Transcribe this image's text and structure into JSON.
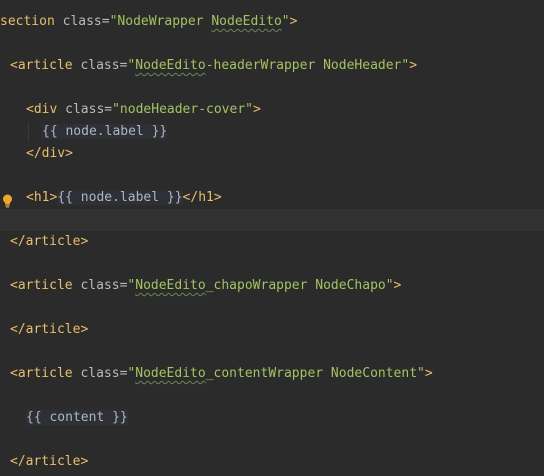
{
  "editor": {
    "lines": {
      "l1": {
        "tag_open": "section",
        "attr_name": "class",
        "attr_value_a": "\"NodeWrapper ",
        "attr_value_b": "NodeEdito",
        "attr_value_c": "\"",
        "tag_close": ">"
      },
      "l2": {
        "tag_open": "<article",
        "attr_name": "class",
        "attr_value_a": "\"",
        "attr_value_b": "NodeEdito",
        "attr_value_c": "-headerWrapper NodeHeader\"",
        "tag_close": ">"
      },
      "l3": {
        "tag_open": "<div",
        "attr_name": "class",
        "attr_value": "\"nodeHeader-cover\"",
        "tag_close": ">"
      },
      "l4": {
        "expr": "{{ node.label }}"
      },
      "l5": {
        "tag": "</div>"
      },
      "l6": {
        "tag_open": "<h1>",
        "expr": "{{ node.label }}",
        "tag_close": "</h1>"
      },
      "l7": {
        "tag": "</article>"
      },
      "l8": {
        "tag_open": "<article",
        "attr_name": "class",
        "attr_value_a": "\"",
        "attr_value_b": "NodeEdito",
        "attr_value_c": "_chapoWrapper NodeChapo\"",
        "tag_close": ">"
      },
      "l9": {
        "tag": "</article>"
      },
      "l10": {
        "tag_open": "<article",
        "attr_name": "class",
        "attr_value_a": "\"",
        "attr_value_b": "NodeEdito",
        "attr_value_c": "_contentWrapper NodeContent\"",
        "tag_close": ">"
      },
      "l11": {
        "expr": "{{ content }}"
      },
      "l12": {
        "tag": "</article>"
      }
    },
    "gutter_icon": "lightbulb-icon",
    "colors": {
      "background": "#2b2b2b",
      "tag": "#e8bf6a",
      "string": "#a5c261",
      "attribute": "#bababa",
      "text": "#a9b7c6",
      "bulb": "#f0a732"
    }
  }
}
